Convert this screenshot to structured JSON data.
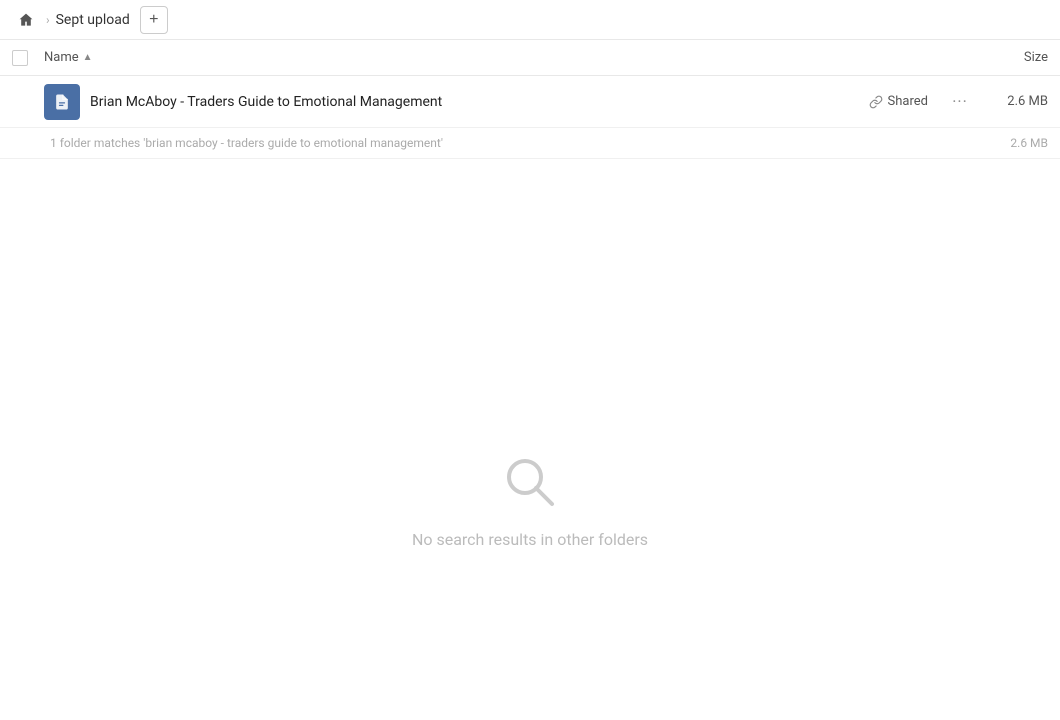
{
  "breadcrumb": {
    "home_label": "Home",
    "separator": "›",
    "folder_name": "Sept upload",
    "add_button_label": "+"
  },
  "columns": {
    "name_label": "Name",
    "sort_arrow": "▲",
    "size_label": "Size"
  },
  "file_item": {
    "name": "Brian McAboy - Traders Guide to Emotional Management",
    "shared_label": "Shared",
    "size": "2.6 MB",
    "icon_alt": "file-icon"
  },
  "match_info": {
    "text": "1 folder matches 'brian mcaboy - traders guide to emotional management'",
    "size": "2.6 MB"
  },
  "empty_state": {
    "label": "No search results in other folders",
    "icon": "search"
  }
}
